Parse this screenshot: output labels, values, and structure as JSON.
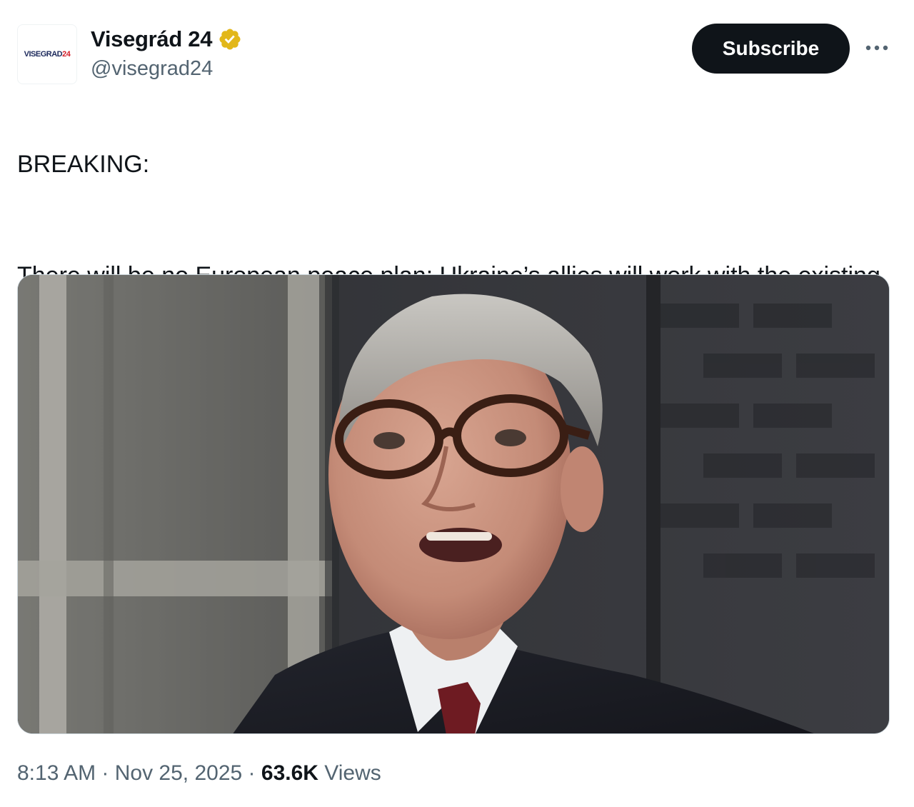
{
  "account": {
    "avatar_logo_main": "VISEGRAD",
    "avatar_logo_accent": "24",
    "display_name": "Visegrád 24",
    "handle": "@visegrad24",
    "verified_badge_icon": "verified-gold-badge-icon",
    "badge_color": "#e2b719"
  },
  "actions": {
    "subscribe_label": "Subscribe",
    "more_icon": "more-horizontal-icon"
  },
  "tweet": {
    "paragraphs": [
      "BREAKING:",
      "There will be no European peace plan: Ukraine’s allies will work with the existing U.S. plan, British Prime Minister Keir Starmer said."
    ]
  },
  "media": {
    "type": "photo"
  },
  "meta": {
    "time": "8:13 AM",
    "separator": " · ",
    "date": "Nov 25, 2025",
    "views_count": "63.6K",
    "views_label": " Views"
  },
  "colors": {
    "text_primary": "#0f1419",
    "text_secondary": "#536471",
    "button_bg": "#0f1419",
    "border": "#cfd9de"
  }
}
